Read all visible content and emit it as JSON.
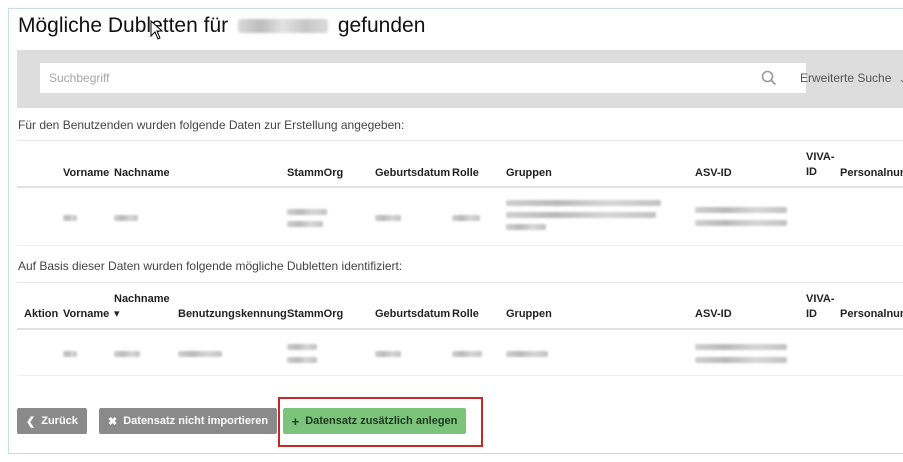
{
  "title": {
    "prefix": "Mögliche Dubletten für",
    "suffix": "gefunden"
  },
  "search": {
    "placeholder": "Suchbegriff",
    "advanced_label": "Erweiterte Suche",
    "icon": "search-icon"
  },
  "section1": {
    "text": "Für den Benutzenden wurden folgende Daten zur Erstellung angegeben:",
    "headers": {
      "vorname": "Vorname",
      "nachname": "Nachname",
      "stammorg": "StammOrg",
      "geburtsdatum": "Geburtsdatum",
      "rolle": "Rolle",
      "gruppen": "Gruppen",
      "asvid": "ASV-ID",
      "viva1": "VIVA-",
      "viva2": "ID",
      "personalnum": "Personalnum"
    }
  },
  "section2": {
    "text": "Auf Basis dieser Daten wurden folgende mögliche Dubletten identifiziert:",
    "headers": {
      "aktion": "Aktion",
      "vorname": "Vorname",
      "nachname": "Nachname",
      "sort_arrow": "▾",
      "benutzungskennung": "Benutzungskennung",
      "stammorg": "StammOrg",
      "geburtsdatum": "Geburtsdatum",
      "rolle": "Rolle",
      "gruppen": "Gruppen",
      "asvid": "ASV-ID",
      "viva1": "VIVA-",
      "viva2": "ID",
      "personalnum": "Personalnum"
    }
  },
  "buttons": {
    "back": "Zurück",
    "skip": "Datensatz nicht importieren",
    "create": "Datensatz zusätzlich anlegen"
  },
  "colors": {
    "toolbar_bg": "#dddddd",
    "gray_button": "#8a8a8a",
    "green_button": "#7cc37c",
    "highlight_border": "#c62828"
  }
}
